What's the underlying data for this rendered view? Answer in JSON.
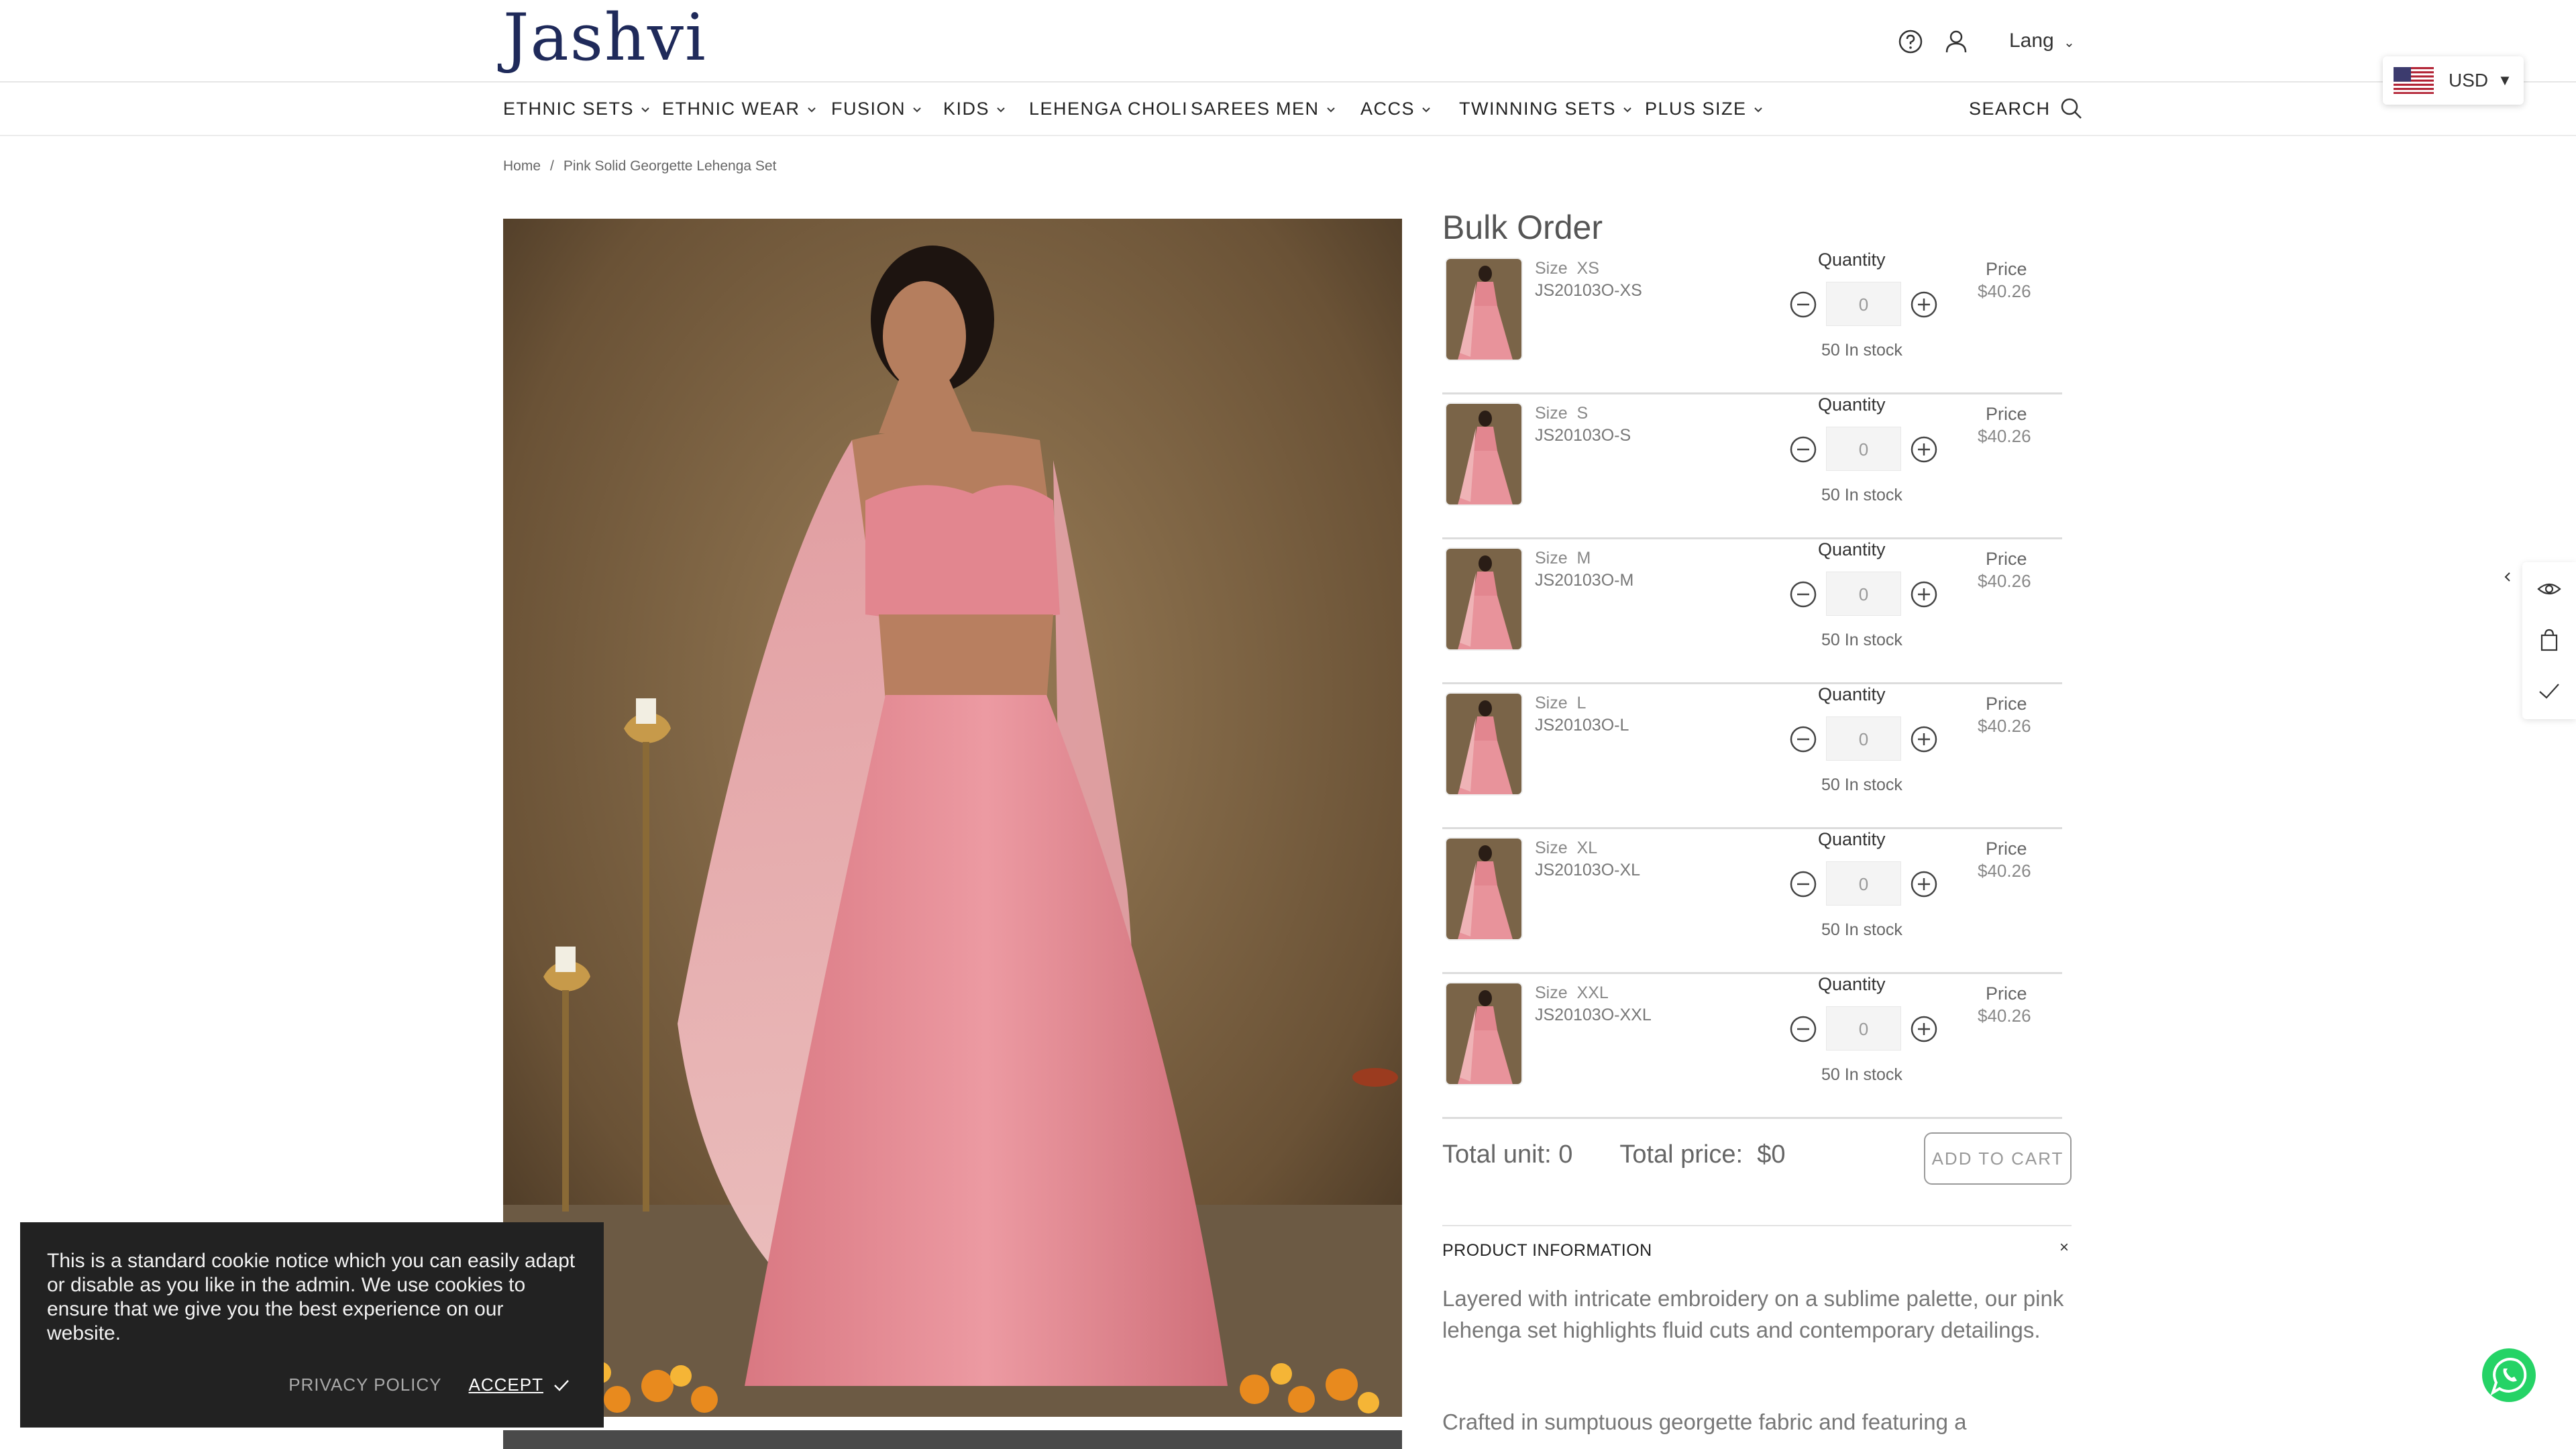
{
  "header": {
    "logo": "Jashvi",
    "lang_label": "Lang",
    "currency": "USD"
  },
  "nav": {
    "items": [
      {
        "label": "ETHNIC SETS",
        "has_dropdown": true
      },
      {
        "label": "ETHNIC WEAR",
        "has_dropdown": true
      },
      {
        "label": "FUSION",
        "has_dropdown": true
      },
      {
        "label": "KIDS",
        "has_dropdown": true
      },
      {
        "label": "LEHENGA CHOLI",
        "has_dropdown": false
      },
      {
        "label": "SAREES",
        "has_dropdown": false
      },
      {
        "label": "MEN",
        "has_dropdown": true
      },
      {
        "label": "ACCS",
        "has_dropdown": true
      },
      {
        "label": "TWINNING SETS",
        "has_dropdown": true
      },
      {
        "label": "PLUS SIZE",
        "has_dropdown": true
      }
    ],
    "search_label": "SEARCH"
  },
  "breadcrumb": {
    "home": "Home",
    "separator": "/",
    "current": "Pink Solid Georgette Lehenga Set"
  },
  "bulk": {
    "title": "Bulk Order",
    "quantity_label": "Quantity",
    "price_label": "Price",
    "size_prefix": "Size",
    "rows": [
      {
        "size": "XS",
        "sku": "JS20103O-XS",
        "qty": "0",
        "stock": "50 In stock",
        "price": "$40.26"
      },
      {
        "size": "S",
        "sku": "JS20103O-S",
        "qty": "0",
        "stock": "50 In stock",
        "price": "$40.26"
      },
      {
        "size": "M",
        "sku": "JS20103O-M",
        "qty": "0",
        "stock": "50 In stock",
        "price": "$40.26"
      },
      {
        "size": "L",
        "sku": "JS20103O-L",
        "qty": "0",
        "stock": "50 In stock",
        "price": "$40.26"
      },
      {
        "size": "XL",
        "sku": "JS20103O-XL",
        "qty": "0",
        "stock": "50 In stock",
        "price": "$40.26"
      },
      {
        "size": "XXL",
        "sku": "JS20103O-XXL",
        "qty": "0",
        "stock": "50 In stock",
        "price": "$40.26"
      }
    ],
    "total_unit": "Total unit: 0",
    "total_price": "Total price:  $0",
    "add_to_cart": "ADD TO CART"
  },
  "product_info": {
    "heading": "PRODUCT INFORMATION",
    "close": "×",
    "description": "Layered with intricate embroidery on a sublime palette, our pink lehenga set highlights fluid cuts and contemporary detailings.",
    "description2": "Crafted in sumptuous georgette fabric and featuring a"
  },
  "cookie": {
    "text": "This is a standard cookie notice which you can easily adapt or disable as you like in the admin. We use cookies to ensure that we give you the best experience on our website.",
    "privacy": "PRIVACY POLICY",
    "accept": "ACCEPT"
  },
  "colors": {
    "logo": "#1f2a5a",
    "lehenga_pink": "#e8939b",
    "background": "#7a6448",
    "cookie_bg": "#222222",
    "whatsapp": "#25d366"
  }
}
